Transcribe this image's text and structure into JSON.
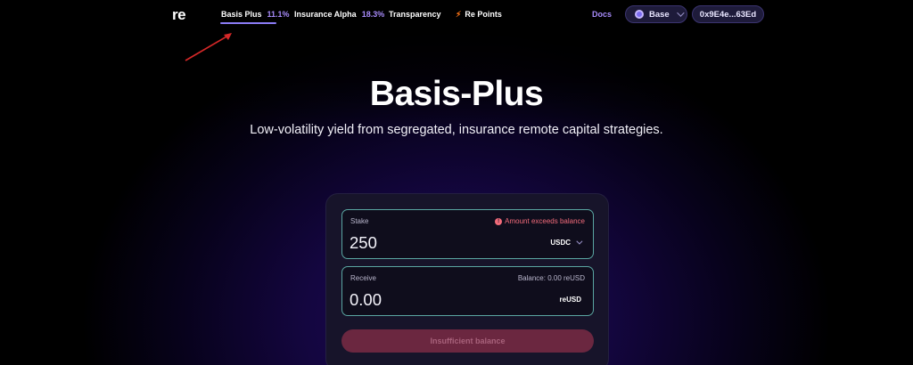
{
  "nav": {
    "logo": "re",
    "links": [
      {
        "label": "Basis Plus",
        "pct": "11.1%"
      },
      {
        "label": "Insurance Alpha",
        "pct": "18.3%"
      },
      {
        "label": "Transparency"
      },
      {
        "label": "Re Points",
        "icon": "bolt-icon"
      }
    ],
    "docs": "Docs",
    "network": "Base",
    "wallet": "0x9E4e...63Ed"
  },
  "hero": {
    "title": "Basis-Plus",
    "subtitle": "Low-volatility yield from segregated, insurance remote capital strategies."
  },
  "form": {
    "stake": {
      "label": "Stake",
      "error": "Amount exceeds balance",
      "value": "250",
      "token": "USDC"
    },
    "receive": {
      "label": "Receive",
      "balance": "Balance: 0.00 reUSD",
      "value": "0.00",
      "token": "reUSD"
    },
    "submit_label": "Insufficient balance"
  },
  "colors": {
    "accent": "#a78bfa",
    "error": "#f26b7a",
    "field_border": "#5aa6a2",
    "submit_bg": "#6b2740"
  }
}
